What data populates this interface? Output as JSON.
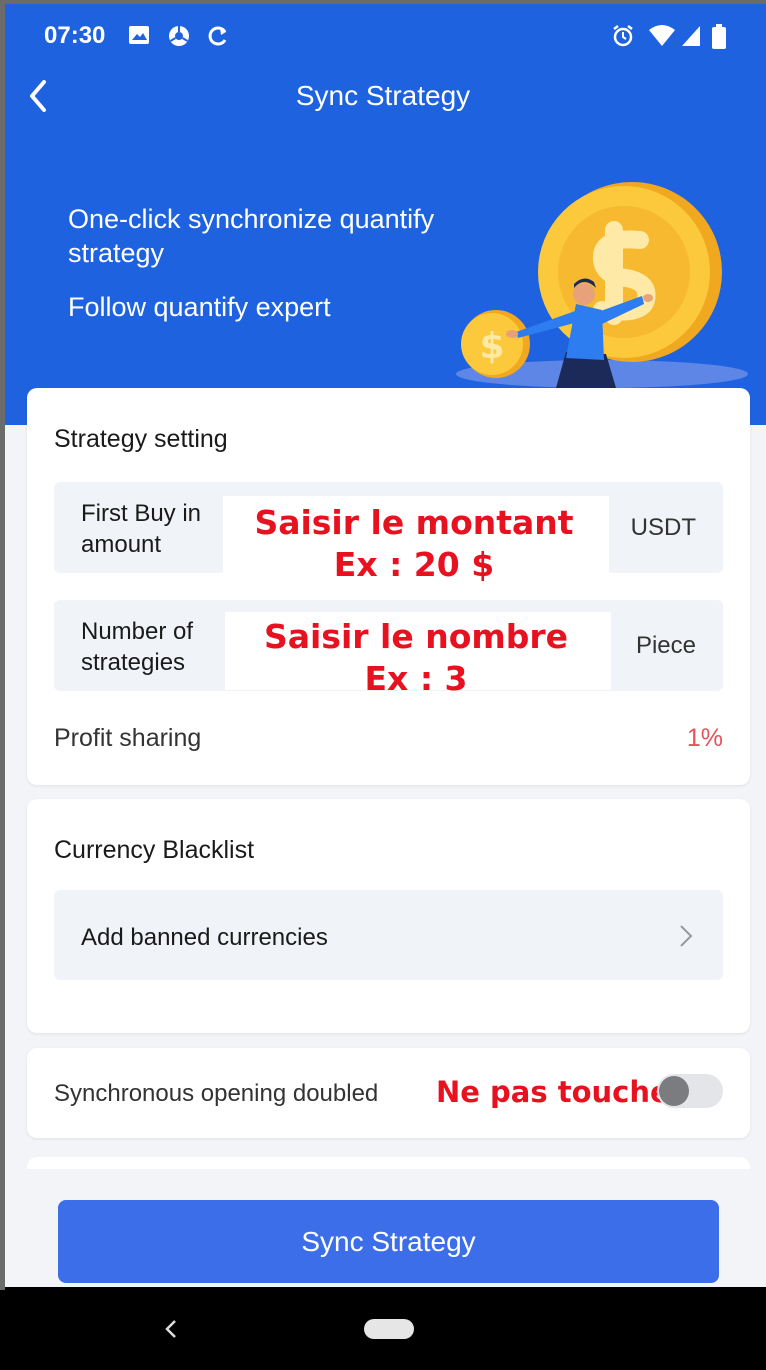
{
  "status_bar": {
    "time": "07:30"
  },
  "header": {
    "title": "Sync Strategy",
    "back_icon": "chevron-left-icon"
  },
  "hero": {
    "line1": "One-click synchronize quantify strategy",
    "line2": "Follow quantify expert"
  },
  "strategy_setting": {
    "title": "Strategy setting",
    "first_buy": {
      "label": "First Buy in amount",
      "unit": "USDT",
      "overlay_line1": "Saisir le montant",
      "overlay_line2": "Ex : 20 $"
    },
    "num_strategies": {
      "label": "Number of strategies",
      "unit": "Piece",
      "overlay_line1": "Saisir le nombre",
      "overlay_line2": "Ex : 3"
    },
    "profit_sharing_label": "Profit sharing",
    "profit_sharing_value": "1%"
  },
  "blacklist": {
    "title": "Currency Blacklist",
    "add_label": "Add banned currencies"
  },
  "sync_opening": {
    "label": "Synchronous opening doubled",
    "overlay": "Ne pas toucher",
    "enabled": false
  },
  "submit": {
    "label": "Sync Strategy"
  },
  "colors": {
    "primary": "#1f62e0",
    "button": "#3b6ee8",
    "overlay_red": "#e8111f",
    "profit_red": "#e5525a"
  }
}
